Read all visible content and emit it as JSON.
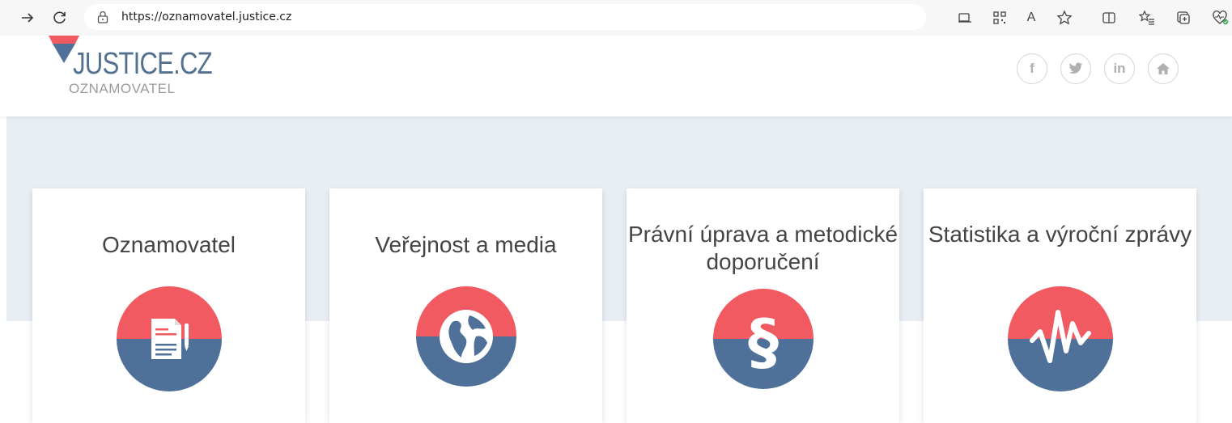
{
  "browser": {
    "url": "https://oznamovatel.justice.cz",
    "read_aloud_label": "A"
  },
  "site": {
    "logo_title": "JUSTICE.CZ",
    "logo_subtitle": "OZNAMOVATEL",
    "social": [
      {
        "icon": "facebook-icon",
        "label": "f"
      },
      {
        "icon": "twitter-icon",
        "label": ""
      },
      {
        "icon": "linkedin-icon",
        "label": "in"
      },
      {
        "icon": "home-icon",
        "label": ""
      }
    ]
  },
  "cards": [
    {
      "title": "Oznamovatel",
      "icon": "document-icon"
    },
    {
      "title": "Veřejnost a media",
      "icon": "globe-icon"
    },
    {
      "title": "Právní úprava a metodické doporučení",
      "icon": "paragraph-icon"
    },
    {
      "title": "Statistika a výroční zprávy",
      "icon": "pulse-icon"
    }
  ],
  "colors": {
    "accent_red": "#f05a60",
    "accent_blue": "#4f7199",
    "hero_bg": "#e9eef5"
  }
}
